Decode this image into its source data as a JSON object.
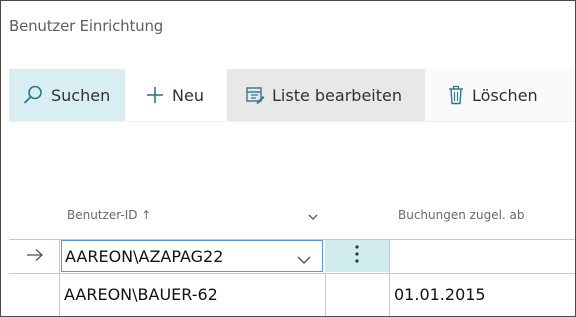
{
  "page": {
    "title": "Benutzer Einrichtung"
  },
  "toolbar": {
    "search_label": "Suchen",
    "new_label": "Neu",
    "edit_list_label": "Liste bearbeiten",
    "delete_label": "Löschen"
  },
  "table": {
    "columns": [
      "Benutzer-ID ↑",
      "Buchungen zugel. ab"
    ],
    "rows": [
      {
        "user_id": "AAREON\\AZAPAG22",
        "postings_allowed_from": ""
      },
      {
        "user_id": "AAREON\\BAUER-62",
        "postings_allowed_from": "01.01.2015"
      }
    ]
  },
  "colors": {
    "accent_selected": "#d8eef2",
    "focus_border": "#5a9ad6"
  },
  "icons": [
    "search-icon",
    "plus-icon",
    "edit-list-icon",
    "trash-icon",
    "chevron-down-icon",
    "arrow-right-icon",
    "more-vertical-icon"
  ]
}
